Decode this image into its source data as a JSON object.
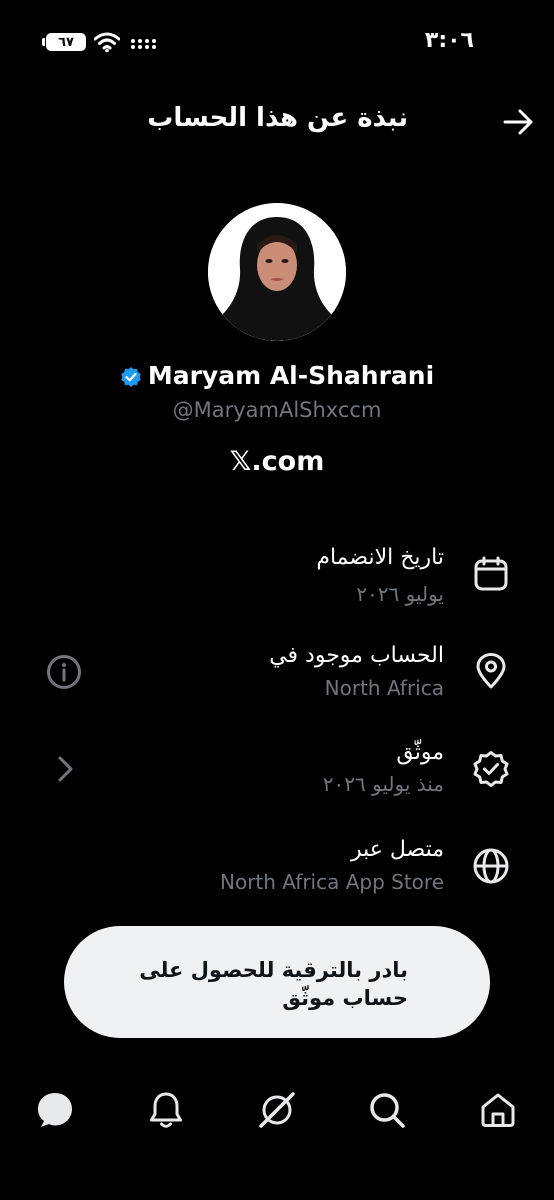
{
  "status_bar": {
    "time": "٣:٠٦",
    "battery_level": "٦٧"
  },
  "header": {
    "title": "نبذة عن هذا الحساب"
  },
  "profile": {
    "display_name": "Maryam Al-Shahrani",
    "handle": "@MaryamAlShxccm",
    "x_logo": "𝕏",
    "site": ".com"
  },
  "info_rows": [
    {
      "title": "تاريخ الانضمام",
      "subtitle": "يوليو ٢٠٢٦",
      "icon": "calendar-icon"
    },
    {
      "title": "الحساب موجود في",
      "subtitle": "North Africa",
      "icon": "location-pin-icon"
    },
    {
      "title": "موثّق",
      "subtitle": "منذ يوليو ٢٠٢٦",
      "icon": "verified-badge-icon"
    },
    {
      "title": "متصل عبر",
      "subtitle": "North Africa App Store",
      "icon": "globe-icon"
    }
  ],
  "banner": {
    "text": "بادر بالترقية للحصول على حساب موثّق"
  },
  "bottom_nav": [
    "messages-icon",
    "notifications-icon",
    "grok-icon",
    "search-icon",
    "home-icon"
  ],
  "colors": {
    "background": "#000000",
    "primary_text": "#ffffff",
    "secondary_text": "#71767b",
    "verified_blue": "#1d9bf0",
    "banner_bg": "#eff1f2"
  }
}
